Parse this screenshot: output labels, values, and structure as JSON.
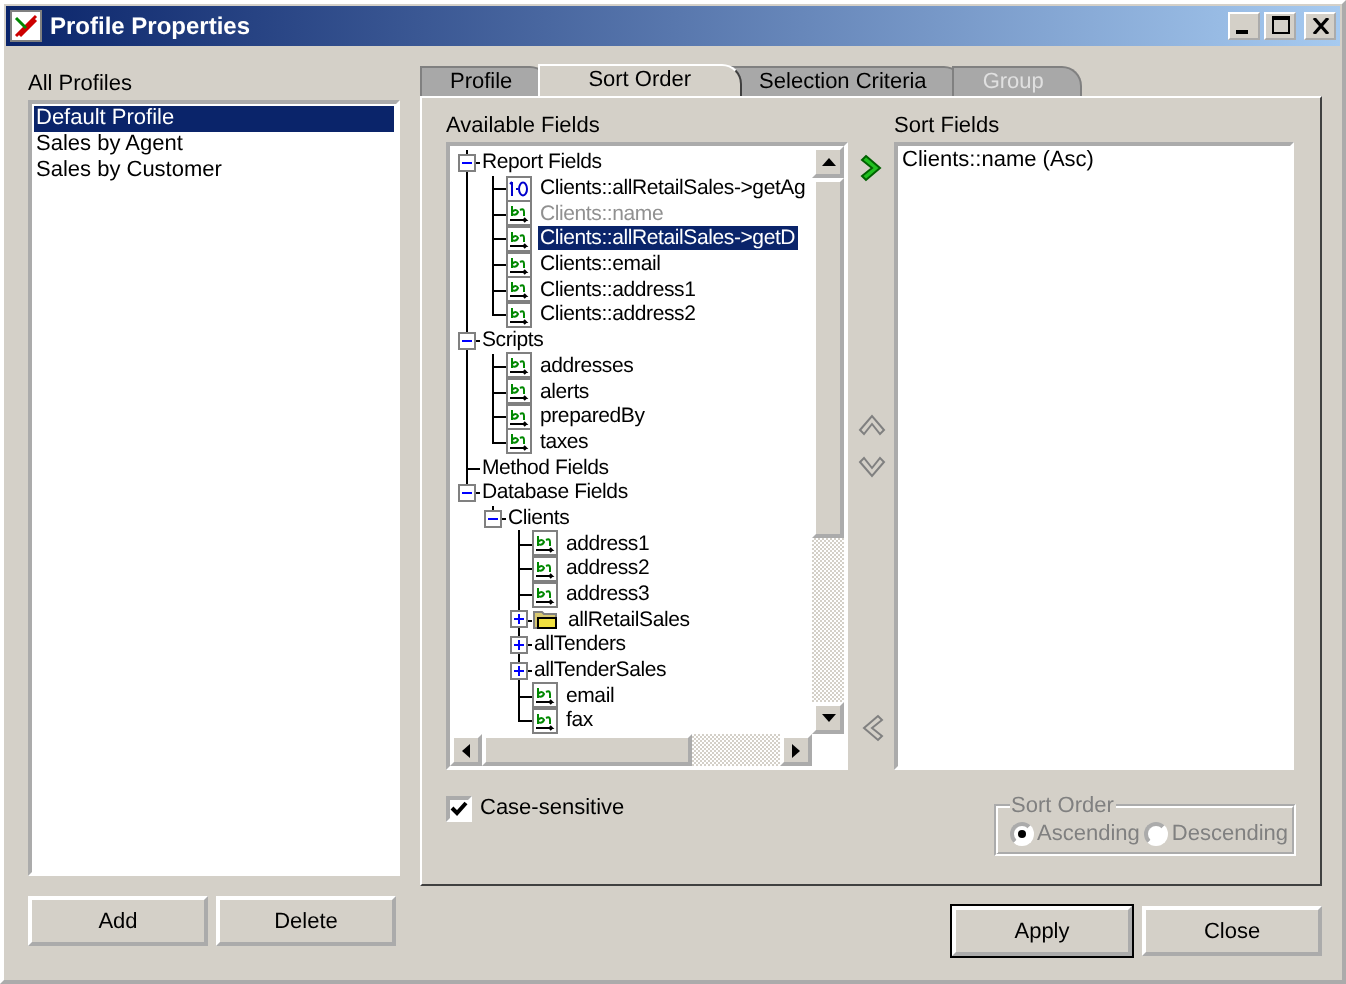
{
  "window": {
    "title": "Profile Properties"
  },
  "profiles": {
    "label": "All Profiles",
    "items": [
      {
        "label": "Default Profile",
        "selected": true
      },
      {
        "label": "Sales by Agent",
        "selected": false
      },
      {
        "label": "Sales by Customer",
        "selected": false
      }
    ]
  },
  "tabs": [
    {
      "label": "Profile",
      "selected": false,
      "disabled": false
    },
    {
      "label": "Sort Order",
      "selected": true,
      "disabled": false
    },
    {
      "label": "Selection Criteria",
      "selected": false,
      "disabled": false
    },
    {
      "label": "Group",
      "selected": false,
      "disabled": true
    }
  ],
  "available_fields": {
    "label": "Available Fields",
    "tree": [
      {
        "label": "Report Fields",
        "expanded": true,
        "selected": false,
        "disabled": false,
        "children": [
          {
            "label": "Clients::allRetailSales->getAg",
            "kind": "number",
            "selected": false,
            "disabled": false
          },
          {
            "label": "Clients::name",
            "kind": "text",
            "selected": false,
            "disabled": true
          },
          {
            "label": "Clients::allRetailSales->getD",
            "kind": "text",
            "selected": true,
            "disabled": false
          },
          {
            "label": "Clients::email",
            "kind": "text",
            "selected": false,
            "disabled": false
          },
          {
            "label": "Clients::address1",
            "kind": "text",
            "selected": false,
            "disabled": false
          },
          {
            "label": "Clients::address2",
            "kind": "text",
            "selected": false,
            "disabled": false
          }
        ]
      },
      {
        "label": "Scripts",
        "expanded": true,
        "selected": false,
        "disabled": false,
        "children": [
          {
            "label": "addresses",
            "kind": "text",
            "selected": false,
            "disabled": false
          },
          {
            "label": "alerts",
            "kind": "text",
            "selected": false,
            "disabled": false
          },
          {
            "label": "preparedBy",
            "kind": "text",
            "selected": false,
            "disabled": false
          },
          {
            "label": "taxes",
            "kind": "text",
            "selected": false,
            "disabled": false
          }
        ]
      },
      {
        "label": "Method Fields",
        "selected": false,
        "disabled": false
      },
      {
        "label": "Database Fields",
        "expanded": true,
        "selected": false,
        "disabled": false,
        "children": [
          {
            "label": "Clients",
            "expanded": true,
            "selected": false,
            "disabled": false,
            "children": [
              {
                "label": "address1",
                "kind": "text",
                "selected": false,
                "disabled": false
              },
              {
                "label": "address2",
                "kind": "text",
                "selected": false,
                "disabled": false
              },
              {
                "label": "address3",
                "kind": "text",
                "selected": false,
                "disabled": false
              },
              {
                "label": "allRetailSales",
                "kind": "folder",
                "expanded": false,
                "selected": false,
                "disabled": false
              },
              {
                "label": "allTenders",
                "expanded": false,
                "selected": false,
                "disabled": false
              },
              {
                "label": "allTenderSales",
                "expanded": false,
                "selected": false,
                "disabled": false
              },
              {
                "label": "email",
                "kind": "text",
                "selected": false,
                "disabled": false
              },
              {
                "label": "fax",
                "kind": "text",
                "selected": false,
                "disabled": false
              }
            ]
          }
        ]
      }
    ]
  },
  "move_buttons": [
    {
      "kind": "add",
      "disabled": false
    },
    {
      "kind": "up",
      "disabled": true
    },
    {
      "kind": "down",
      "disabled": true
    },
    {
      "kind": "remove",
      "disabled": true
    }
  ],
  "sort_fields": {
    "label": "Sort Fields",
    "items": [
      {
        "label": "Clients::name (Asc)",
        "selected": false
      }
    ]
  },
  "case_sensitive": {
    "label": "Case-sensitive",
    "checked": true
  },
  "sort_order": {
    "label": "Sort Order",
    "disabled": true,
    "options": [
      {
        "label": "Ascending",
        "selected": true
      },
      {
        "label": "Descending",
        "selected": false
      }
    ]
  },
  "profile_buttons": [
    "Add",
    "Delete"
  ],
  "dialog_buttons": [
    {
      "label": "Apply",
      "default": true
    },
    {
      "label": "Close",
      "default": false
    }
  ]
}
